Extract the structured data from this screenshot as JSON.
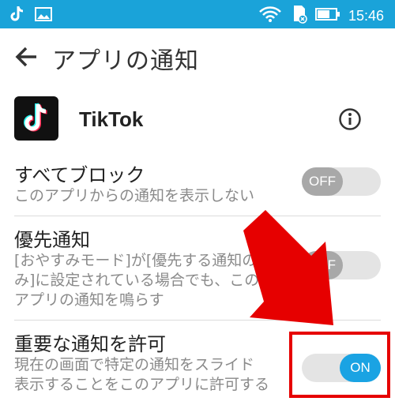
{
  "status_bar": {
    "left_icons": [
      "tiktok-icon",
      "image-icon"
    ],
    "right_icons": [
      "wifi-icon",
      "sd-card-icon",
      "battery-icon"
    ],
    "time": "15:46",
    "color": "#1aa3d9"
  },
  "header": {
    "back_icon": "back-arrow-icon",
    "title": "アプリの通知"
  },
  "app": {
    "name": "TikTok",
    "info_icon": "info-icon"
  },
  "settings": [
    {
      "label": "すべてブロック",
      "desc_lines": [
        "このアプリからの通知を表示しない"
      ],
      "toggle": "OFF"
    },
    {
      "label": "優先通知",
      "desc_lines": [
        "[おやすみモード]が[優先する通知の",
        "み]に設定されている場合でも、この",
        "アプリの通知を鳴らす"
      ],
      "toggle": "OFF"
    },
    {
      "label": "重要な通知を許可",
      "desc_lines": [
        "現在の画面で特定の通知をスライド",
        "表示することをこのアプリに許可する"
      ],
      "toggle": "ON"
    }
  ],
  "annotation": {
    "arrow_color": "#e60000",
    "highlight_target": "重要な通知を許可"
  }
}
